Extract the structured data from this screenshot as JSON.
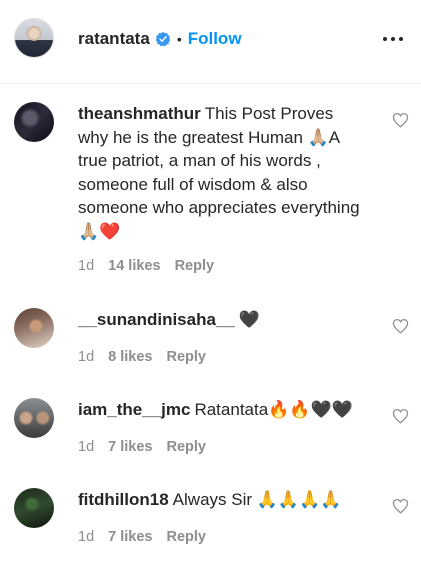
{
  "post_header": {
    "username": "ratantata",
    "separator": "•",
    "follow_label": "Follow"
  },
  "comments": [
    {
      "username": "theanshmathur",
      "text": "This Post Proves why he is the greatest Human 🙏🏼A true patriot, a man of his words , someone full of wisdom & also someone who appreciates everything 🙏🏼❤️",
      "time": "1d",
      "likes": "14 likes",
      "reply_label": "Reply"
    },
    {
      "username": "__sunandinisaha__",
      "text": "🖤",
      "time": "1d",
      "likes": "8 likes",
      "reply_label": "Reply"
    },
    {
      "username": "iam_the__jmc",
      "text": "Ratantata🔥🔥🖤🖤",
      "time": "1d",
      "likes": "7 likes",
      "reply_label": "Reply"
    },
    {
      "username": "fitdhillon18",
      "text": "Always Sir 🙏🙏🙏🙏",
      "time": "1d",
      "likes": "7 likes",
      "reply_label": "Reply"
    }
  ],
  "icons": {
    "verified": "verified-badge-icon",
    "more": "more-options-icon",
    "like": "heart-outline-icon"
  },
  "colors": {
    "link_blue": "#0095f6",
    "verified_blue": "#3897f0",
    "text": "#262626",
    "muted": "#8e8e8e"
  }
}
